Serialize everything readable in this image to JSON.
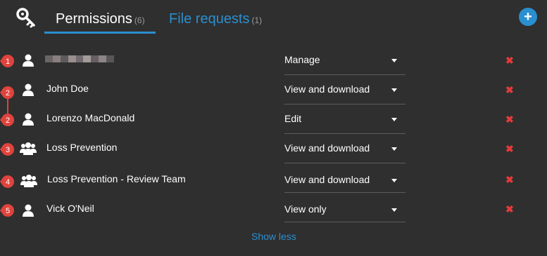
{
  "tabs": {
    "permissions": {
      "label": "Permissions",
      "count": "(6)"
    },
    "file_requests": {
      "label": "File requests",
      "count": "(1)"
    }
  },
  "header": {
    "add_symbol": "+"
  },
  "rows": [
    {
      "badge": "1",
      "type": "user",
      "name": "",
      "permission": "Manage"
    },
    {
      "badge": "2",
      "type": "user",
      "name": "John Doe",
      "permission": "View and download"
    },
    {
      "badge": "2",
      "type": "user",
      "name": "Lorenzo MacDonald",
      "permission": "Edit"
    },
    {
      "badge": "3",
      "type": "group",
      "name": "Loss Prevention",
      "permission": "View and download"
    },
    {
      "badge": "4",
      "type": "group",
      "name": "Loss Prevention - Review Team",
      "permission": "View and download"
    },
    {
      "badge": "5",
      "type": "user",
      "name": "Vick O'Neil",
      "permission": "View only"
    }
  ],
  "remove_symbol": "✖",
  "footer": {
    "show_less": "Show less"
  },
  "colors": {
    "accent": "#2a8fd0",
    "badge": "#e0433d",
    "remove": "#e33b3b",
    "background": "#2f2f2f"
  }
}
